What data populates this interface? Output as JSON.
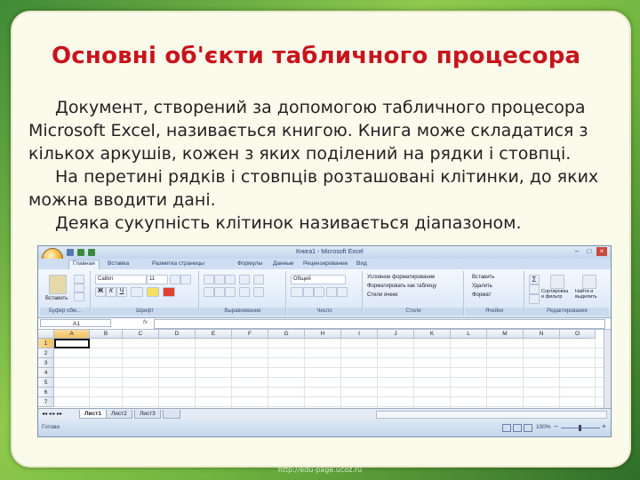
{
  "slide": {
    "title": "Основні об'єкти табличного процесора",
    "paragraphs": [
      "Документ, створений за допомогою табличного процесора Microsoft Excel, називається книгою. Книга може складатися з кількох аркушів, кожен з яких поділений на рядки і стовпці.",
      "На перетині рядків і стовпців розташовані клітинки, до яких можна вводити дані.",
      "Деяка сукупність клітинок називається діапазоном."
    ],
    "footer": "http://edu-page.ucoz.ru"
  },
  "excel": {
    "window_title": "Книга1 - Microsoft Excel",
    "tabs": [
      "Главная",
      "Вставка",
      "Разметка страницы",
      "Формулы",
      "Данные",
      "Рецензирование",
      "Вид"
    ],
    "groups": [
      "Буфер обм...",
      "Шрифт",
      "Выравнивание",
      "Число",
      "Стили",
      "Ячейки",
      "Редактирование"
    ],
    "buttons": {
      "paste": "Вставить",
      "font_name": "Calibri",
      "font_size": "11",
      "number_format": "Общий",
      "conditional": "Условное форматирование",
      "format_table": "Форматировать как таблицу",
      "cell_styles": "Стили ячеек",
      "insert": "Вставить",
      "delete": "Удалить",
      "format": "Формат",
      "sort": "Сортировка и фильтр",
      "find": "Найти и выделить"
    },
    "name_box": "A1",
    "fx_label": "fx",
    "columns": [
      "A",
      "B",
      "C",
      "D",
      "E",
      "F",
      "G",
      "H",
      "I",
      "J",
      "K",
      "L",
      "M",
      "N",
      "O"
    ],
    "rows": [
      "1",
      "2",
      "3",
      "4",
      "5",
      "6",
      "7"
    ],
    "sheets": [
      "Лист1",
      "Лист2",
      "Лист3"
    ],
    "status_ready": "Готово",
    "zoom": "100%"
  },
  "colors": {
    "title": "#c8141c",
    "background_green": "#6fb43f",
    "card": "#fbfbec"
  }
}
